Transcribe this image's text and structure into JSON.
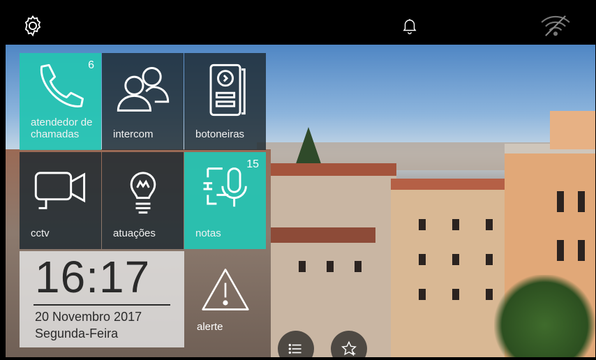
{
  "topbar": {
    "settings_icon": "gear-icon",
    "bell_icon": "bell-icon",
    "wifi_icon": "wifi-off-icon"
  },
  "tiles": [
    {
      "id": "atendedor",
      "label": "atendedor de chamadas",
      "badge": "6",
      "icon": "phone-icon",
      "style": "teal"
    },
    {
      "id": "intercom",
      "label": "intercom",
      "badge": "",
      "icon": "users-icon",
      "style": "dark"
    },
    {
      "id": "botoneiras",
      "label": "botoneiras",
      "badge": "",
      "icon": "doorbell-panel-icon",
      "style": "dark"
    },
    {
      "id": "cctv",
      "label": "cctv",
      "badge": "",
      "icon": "video-camera-icon",
      "style": "dark"
    },
    {
      "id": "atuacoes",
      "label": "atuações",
      "badge": "",
      "icon": "lightbulb-icon",
      "style": "dark"
    },
    {
      "id": "notas",
      "label": "notas",
      "badge": "15",
      "icon": "voice-note-icon",
      "style": "teal"
    }
  ],
  "clock": {
    "time": "16:17",
    "date": "20 Novembro 2017",
    "weekday": "Segunda-Feira"
  },
  "alert": {
    "label": "alerte",
    "icon": "warning-icon"
  },
  "bottom_buttons": [
    {
      "icon": "list-icon"
    },
    {
      "icon": "star-add-icon"
    }
  ],
  "colors": {
    "accent_teal": "#26c3b2",
    "tile_dark": "#1c2830",
    "clock_panel": "#e6e6e6"
  }
}
